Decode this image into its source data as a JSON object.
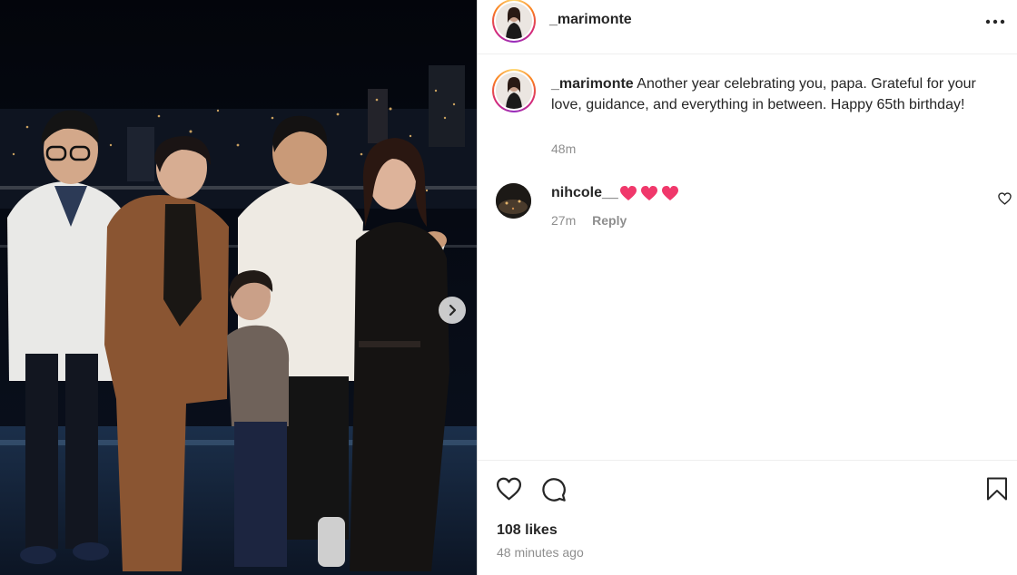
{
  "post": {
    "username": "_marimonte",
    "photo_alt": "Family photo on a rooftop at night",
    "caption": "Another year celebrating you, papa. Grateful for your love, guidance, and everything in between. Happy 65th birthday!",
    "caption_time": "48m",
    "likes": "108 likes",
    "posted_ago": "48 minutes ago"
  },
  "comments": [
    {
      "username": "nihcole__",
      "emojis": [
        "heart",
        "heart",
        "heart"
      ],
      "time": "27m",
      "reply_label": "Reply"
    }
  ],
  "icons": {
    "more": "more-horizontal-icon",
    "next": "chevron-right-icon",
    "like": "heart-icon",
    "comment": "comment-icon",
    "save": "bookmark-icon"
  },
  "colors": {
    "text": "#262626",
    "muted": "#8e8e8e",
    "heart_emoji": "#f0386b",
    "story_ring": "#d62976"
  }
}
